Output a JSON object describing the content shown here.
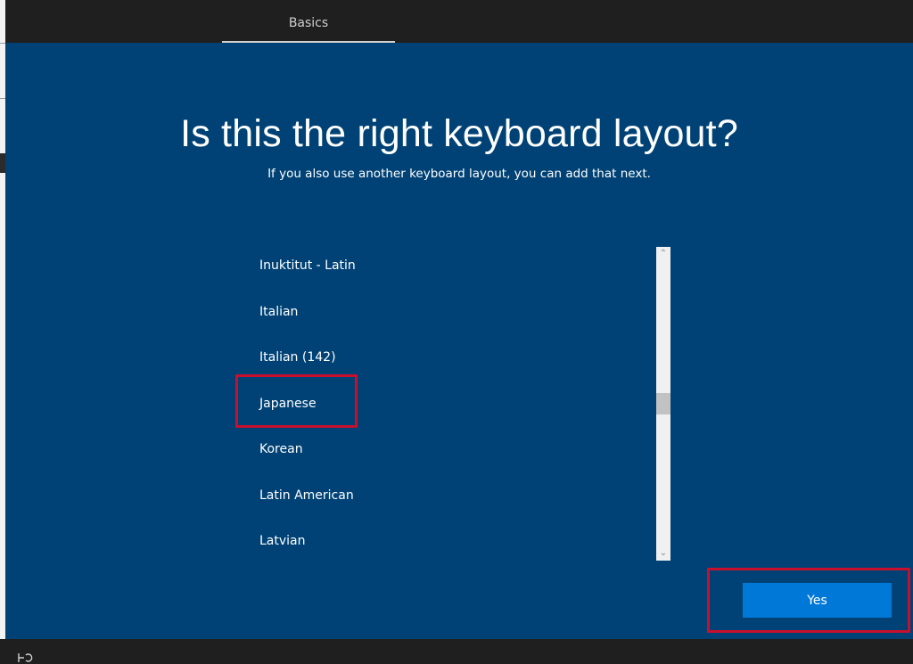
{
  "header": {
    "tab_label": "Basics"
  },
  "main": {
    "title": "Is this the right keyboard layout?",
    "subtitle": "If you also use another keyboard layout, you can add that next.",
    "layouts": [
      "Inuktitut - Latin",
      "Italian",
      "Italian (142)",
      "Japanese",
      "Korean",
      "Latin American",
      "Latvian"
    ],
    "selected_layout": "Japanese"
  },
  "footer": {
    "yes_label": "Yes",
    "accessibility_icon": "accessibility-icon"
  },
  "colors": {
    "background_blue": "#004275",
    "bar_dark": "#1f1f1f",
    "button_blue": "#0078d7",
    "annotation_red": "#c8102e"
  }
}
